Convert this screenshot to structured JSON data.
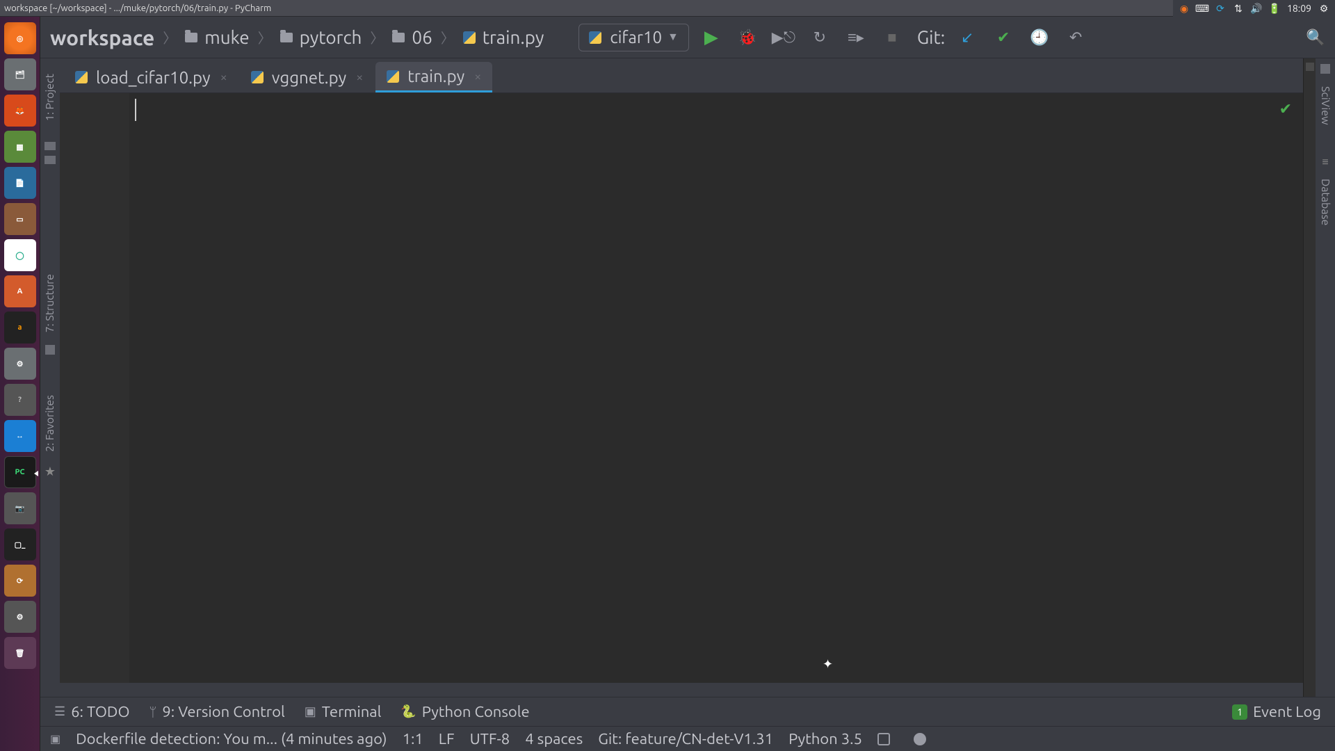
{
  "window_title": "workspace [~/workspace] - .../muke/pytorch/06/train.py - PyCharm",
  "tray": {
    "time": "18:09",
    "icons": [
      "updates",
      "keyboard",
      "sync",
      "network",
      "volume",
      "battery",
      "settings"
    ]
  },
  "launcher_items": [
    "ubuntu",
    "files",
    "firefox",
    "calc",
    "writer",
    "impress",
    "chrome",
    "store",
    "amazon",
    "settings-app",
    "help",
    "teamviewer",
    "pycharm",
    "camera",
    "terminal",
    "updater",
    "system-settings",
    "trash"
  ],
  "breadcrumbs": [
    "workspace",
    "muke",
    "pytorch",
    "06",
    "train.py"
  ],
  "run_config": {
    "name": "cifar10"
  },
  "toolbar": {
    "git_label": "Git:"
  },
  "side_left_tabs": [
    {
      "id": "project",
      "label": "1: Project"
    },
    {
      "id": "structure",
      "label": "7: Structure"
    },
    {
      "id": "favorites",
      "label": "2: Favorites"
    }
  ],
  "side_right_tabs": [
    {
      "id": "sciview",
      "label": "SciView"
    },
    {
      "id": "database",
      "label": "Database"
    }
  ],
  "editor_tabs": [
    {
      "file": "load_cifar10.py",
      "active": false
    },
    {
      "file": "vggnet.py",
      "active": false
    },
    {
      "file": "train.py",
      "active": true
    }
  ],
  "bottom_tabs": {
    "todo": "6: TODO",
    "vcs": "9: Version Control",
    "terminal": "Terminal",
    "pyconsole": "Python Console",
    "eventlog": "Event Log",
    "eventlog_badge": "1"
  },
  "status": {
    "message": "Dockerfile detection: You m... (4 minutes ago)",
    "caret": "1:1",
    "line_sep": "LF",
    "encoding": "UTF-8",
    "indent": "4 spaces",
    "git_branch": "Git: feature/CN-det-V1.31",
    "python": "Python 3.5"
  }
}
